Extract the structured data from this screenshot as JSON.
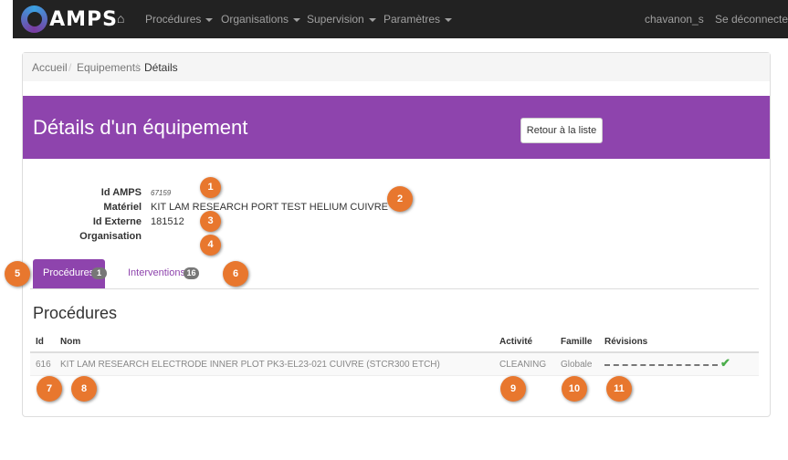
{
  "app": {
    "logo_text": "AMPS"
  },
  "nav": {
    "items": [
      {
        "label": "Procédures"
      },
      {
        "label": "Organisations"
      },
      {
        "label": "Supervision"
      },
      {
        "label": "Paramètres"
      }
    ],
    "user": "chavanon_s",
    "logout": "Se déconnecter"
  },
  "breadcrumb": [
    "Accueil",
    "Equipements",
    "Détails"
  ],
  "header": {
    "title": "Détails d'un équipement",
    "back_button": "Retour à la liste"
  },
  "details": [
    {
      "label": "Id AMPS",
      "value": "67159"
    },
    {
      "label": "Matériel",
      "value": "KIT LAM RESEARCH PORT TEST HELIUM CUIVRE"
    },
    {
      "label": "Id Externe",
      "value": "181512"
    },
    {
      "label": "Organisation",
      "value": ""
    }
  ],
  "tabs": [
    {
      "label": "Procédures",
      "count": "1",
      "active": true
    },
    {
      "label": "Interventions",
      "count": "16",
      "active": false
    }
  ],
  "section_title": "Procédures",
  "table": {
    "headers": {
      "id": "Id",
      "name": "Nom",
      "activity": "Activité",
      "family": "Famille",
      "revisions": "Révisions"
    },
    "rows": [
      {
        "id": "616",
        "name": "KIT LAM RESEARCH ELECTRODE INNER PLOT PK3-EL23-021 CUIVRE (STCR300 ETCH)",
        "activity": "CLEANING",
        "family": "Globale"
      }
    ]
  },
  "markers": [
    "1",
    "2",
    "3",
    "4",
    "5",
    "6",
    "7",
    "8",
    "9",
    "10",
    "11"
  ],
  "colors": {
    "navbar": "#222222",
    "accent": "#8e44ad",
    "marker": "#e8772e",
    "success": "#4cae4c"
  },
  "icons": {
    "home": "home-icon",
    "check": "check-icon",
    "caret": "caret-down-icon"
  }
}
